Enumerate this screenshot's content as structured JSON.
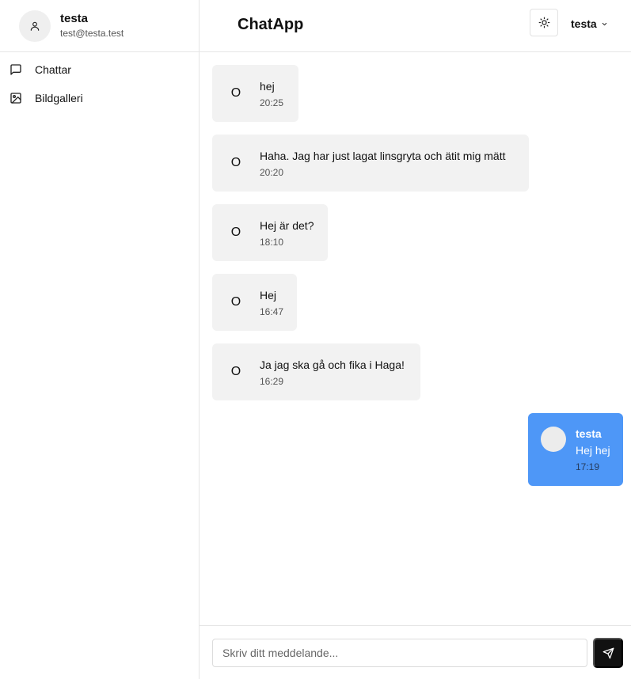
{
  "user": {
    "name": "testa",
    "email": "test@testa.test",
    "avatar_icon": "user-icon"
  },
  "sidebar": {
    "items": [
      {
        "label": "Chattar",
        "icon": "message-square-icon"
      },
      {
        "label": "Bildgalleri",
        "icon": "image-icon"
      }
    ]
  },
  "header": {
    "title": "ChatApp",
    "theme_icon": "sun-icon",
    "user_menu_label": "testa",
    "user_menu_icon": "chevron-down-icon"
  },
  "messages": [
    {
      "initial": "O",
      "text": "hej",
      "time": "20:25"
    },
    {
      "initial": "O",
      "text": "Haha. Jag har just lagat linsgryta och ätit mig mätt",
      "time": "20:20"
    },
    {
      "initial": "O",
      "text": "Hej är det?",
      "time": "18:10"
    },
    {
      "initial": "O",
      "text": "Hej",
      "time": "16:47"
    },
    {
      "initial": "O",
      "text": "Ja jag ska gå och fika i Haga!",
      "time": "16:29"
    }
  ],
  "own_message": {
    "sender": "testa",
    "text": "Hej hej",
    "time": "17:19"
  },
  "composer": {
    "placeholder": "Skriv ditt meddelande...",
    "value": "",
    "send_icon": "send-icon"
  },
  "colors": {
    "own_bubble": "#4e97f7",
    "other_bubble": "#f2f2f2",
    "send_button": "#111111"
  }
}
